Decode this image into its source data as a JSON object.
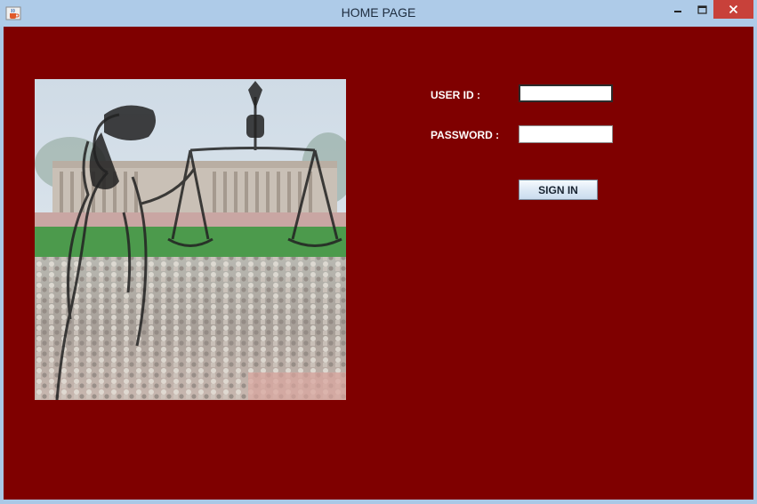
{
  "window": {
    "title": "HOME PAGE",
    "icon": "java-coffee-cup-icon",
    "controls": {
      "minimize": "minimize-icon",
      "maximize": "maximize-icon",
      "close": "close-icon"
    }
  },
  "colors": {
    "background": "#7f0000",
    "titlebar": "#aecbe8",
    "close_button": "#c8413a"
  },
  "login": {
    "userid_label": "USER ID :",
    "userid_value": "",
    "password_label": "PASSWORD :",
    "password_value": "",
    "signin_label": "SIGN IN"
  },
  "image": {
    "icon": "justice-scales-parliament-crowd-image"
  }
}
